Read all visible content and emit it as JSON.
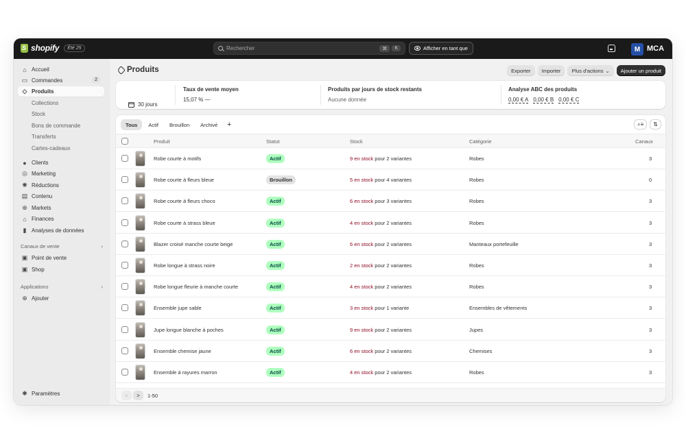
{
  "topbar": {
    "brand": "shopify",
    "edition": "Été 25",
    "search_placeholder": "Rechercher",
    "shortcut_mod": "⌘",
    "shortcut_key": "K",
    "view_as_label": "Afficher en tant que",
    "store_initial": "M",
    "store_name": "MCA"
  },
  "sidebar": {
    "items": [
      {
        "label": "Accueil",
        "icon": "home-icon"
      },
      {
        "label": "Commandes",
        "icon": "inbox-icon",
        "badge": "2"
      },
      {
        "label": "Produits",
        "icon": "tag-icon"
      },
      {
        "label": "Collections"
      },
      {
        "label": "Stock"
      },
      {
        "label": "Bons de commande"
      },
      {
        "label": "Transferts"
      },
      {
        "label": "Cartes-cadeaux"
      },
      {
        "label": "Clients",
        "icon": "person-icon"
      },
      {
        "label": "Marketing",
        "icon": "target-icon"
      },
      {
        "label": "Réductions",
        "icon": "discount-icon"
      },
      {
        "label": "Contenu",
        "icon": "content-icon"
      },
      {
        "label": "Markets",
        "icon": "globe-icon"
      },
      {
        "label": "Finances",
        "icon": "bank-icon"
      },
      {
        "label": "Analyses de données",
        "icon": "bar-chart-icon"
      }
    ],
    "sales_channels_label": "Canaux de vente",
    "channels": [
      {
        "label": "Point de vente",
        "icon": "pos-icon"
      },
      {
        "label": "Shop",
        "icon": "shop-icon"
      }
    ],
    "apps_label": "Applications",
    "add_label": "Ajouter",
    "settings_label": "Paramètres"
  },
  "page": {
    "title": "Produits",
    "actions": {
      "export": "Exporter",
      "import": "Importer",
      "more": "Plus d'actions",
      "add": "Ajouter un produit"
    }
  },
  "stats": {
    "period": "30 jours",
    "sell_through_title": "Taux de vente moyen",
    "sell_through_value": "15,07 % —",
    "days_stock_title": "Produits par jours de stock restants",
    "days_stock_value": "Aucune donnée",
    "abc_title": "Analyse ABC des produits",
    "abc_a": "0,00 € A",
    "abc_b": "0,00 € B",
    "abc_c": "0,00 € C"
  },
  "tabs": [
    "Tous",
    "Actif",
    "Brouillon",
    "Archivé",
    "+"
  ],
  "table": {
    "headers": {
      "product": "Produit",
      "status": "Statut",
      "stock": "Stock",
      "category": "Catégorie",
      "channels": "Canaux"
    },
    "rows": [
      {
        "name": "Robe courte à motifs",
        "status": "Actif",
        "stock_qty": "9 en stock",
        "stock_rest": " pour 2 variantes",
        "category": "Robes",
        "channels": "3"
      },
      {
        "name": "Robe courte à fleurs bleue",
        "status": "Brouillon",
        "stock_qty": "5 en stock",
        "stock_rest": " pour 4 variantes",
        "category": "Robes",
        "channels": "0"
      },
      {
        "name": "Robe courte à fleurs choco",
        "status": "Actif",
        "stock_qty": "6 en stock",
        "stock_rest": " pour 3 variantes",
        "category": "Robes",
        "channels": "3"
      },
      {
        "name": "Robe courte à strass bleue",
        "status": "Actif",
        "stock_qty": "4 en stock",
        "stock_rest": " pour 2 variantes",
        "category": "Robes",
        "channels": "3"
      },
      {
        "name": "Blazer croisé manche courte beige",
        "status": "Actif",
        "stock_qty": "6 en stock",
        "stock_rest": " pour 2 variantes",
        "category": "Manteaux portefeuille",
        "channels": "3"
      },
      {
        "name": "Robe longue à strass noire",
        "status": "Actif",
        "stock_qty": "2 en stock",
        "stock_rest": " pour 2 variantes",
        "category": "Robes",
        "channels": "3"
      },
      {
        "name": "Robe longue fleurie à manche courte",
        "status": "Actif",
        "stock_qty": "4 en stock",
        "stock_rest": " pour 2 variantes",
        "category": "Robes",
        "channels": "3"
      },
      {
        "name": "Ensemble jupe sable",
        "status": "Actif",
        "stock_qty": "3 en stock",
        "stock_rest": " pour 1 variante",
        "category": "Ensembles de vêtements",
        "channels": "3"
      },
      {
        "name": "Jupe longue blanche à poches",
        "status": "Actif",
        "stock_qty": "9 en stock",
        "stock_rest": " pour 2 variantes",
        "category": "Jupes",
        "channels": "3"
      },
      {
        "name": "Ensemble chemise jaune",
        "status": "Actif",
        "stock_qty": "6 en stock",
        "stock_rest": " pour 2 variantes",
        "category": "Chemises",
        "channels": "3"
      },
      {
        "name": "Ensemble à rayures marron",
        "status": "Actif",
        "stock_qty": "4 en stock",
        "stock_rest": " pour 2 variantes",
        "category": "Robes",
        "channels": "3"
      }
    ]
  },
  "pagination": {
    "prev": "<",
    "next": ">",
    "range": "1-50"
  },
  "colors": {
    "active_badge": "#affebf",
    "draft_badge": "#e3e3e3",
    "stock_red": "#8e0b21",
    "topbar": "#1a1a1a"
  }
}
